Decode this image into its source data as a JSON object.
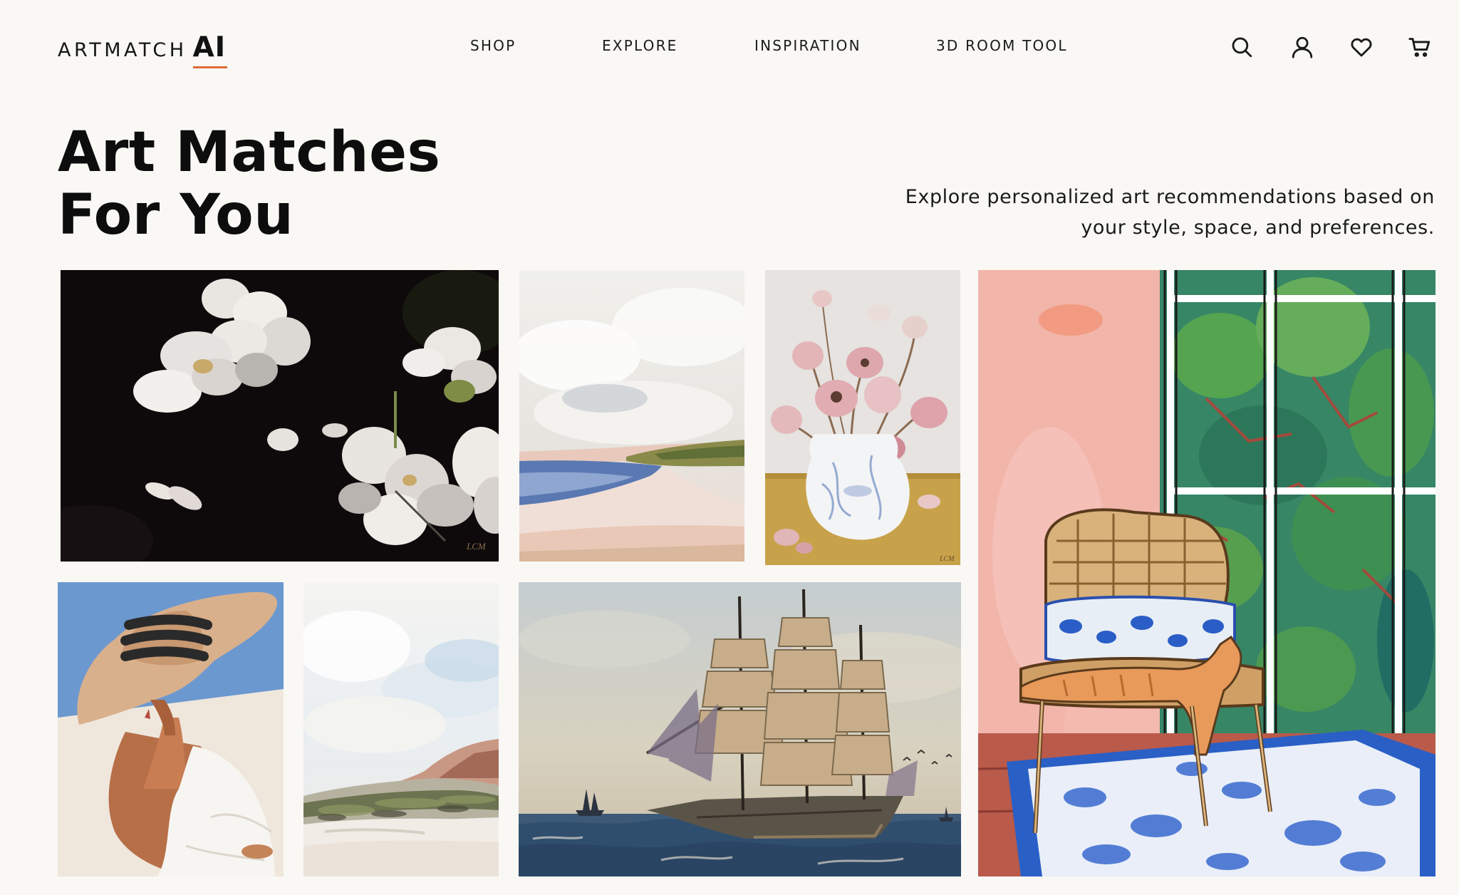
{
  "brand": {
    "name": "ARTMATCH",
    "suffix": "AI",
    "accent_color": "#e06a35"
  },
  "nav": {
    "items": [
      "SHOP",
      "EXPLORE",
      "INSPIRATION",
      "3D ROOM TOOL"
    ]
  },
  "header_icons": [
    "search-icon",
    "account-icon",
    "heart-icon",
    "cart-icon"
  ],
  "hero": {
    "title_line1": "Art Matches",
    "title_line2": "For You",
    "subtitle_line1": "Explore personalized art recommendations based on",
    "subtitle_line2": "your style, space, and preferences."
  },
  "gallery": {
    "artworks": [
      "white-flowers-on-black-painting",
      "coastal-beach-landscape-painting",
      "pink-flowers-in-vase-painting",
      "cat-on-rattan-chair-interior-painting",
      "woman-in-sun-hat-painting",
      "coastal-cliff-landscape-painting",
      "tall-ship-seascape-painting"
    ],
    "signatures": {
      "flowers_black": "LCM",
      "pink_flowers": "LCM"
    }
  }
}
